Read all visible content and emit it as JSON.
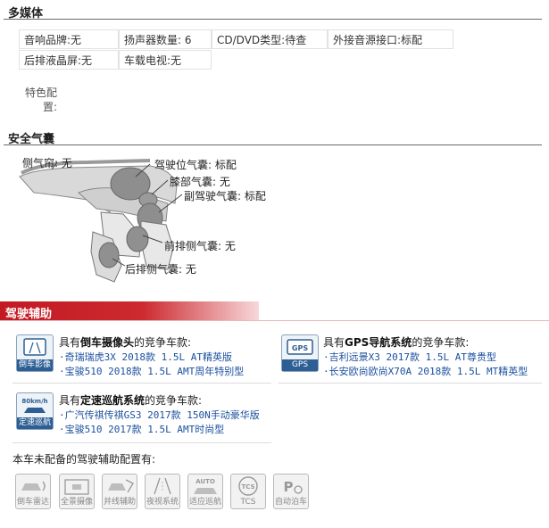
{
  "multimedia": {
    "title": "多媒体",
    "rows": [
      [
        {
          "label": "音响品牌:",
          "value": "无"
        },
        {
          "label": "扬声器数量:",
          "value": "6"
        },
        {
          "label": "CD/DVD类型:",
          "value": "待查"
        },
        {
          "label": "外接音源接口:",
          "value": "标配"
        }
      ],
      [
        {
          "label": "后排液晶屏:",
          "value": "无"
        },
        {
          "label": "车载电视:",
          "value": "无"
        }
      ]
    ],
    "special_label_line1": "特色配",
    "special_label_line2": "置:"
  },
  "airbags": {
    "title": "安全气囊",
    "items": [
      {
        "label": "侧气帘:",
        "value": "无"
      },
      {
        "label": "驾驶位气囊:",
        "value": "标配"
      },
      {
        "label": "膝部气囊:",
        "value": "无"
      },
      {
        "label": "副驾驶气囊:",
        "value": "标配"
      },
      {
        "label": "前排侧气囊:",
        "value": "无"
      },
      {
        "label": "后排侧气囊:",
        "value": "无"
      }
    ]
  },
  "assist": {
    "title": "驾驶辅助",
    "features": [
      {
        "icon_caption": "倒车影像",
        "title_prefix": "具有",
        "title_feature": "倒车摄像头",
        "title_suffix": "的竞争车款:",
        "links": [
          "奇瑞瑞虎3X 2018款 1.5L AT精英版",
          "宝骏510 2018款 1.5L AMT周年特别型"
        ]
      },
      {
        "icon_caption": "GPS",
        "icon_badge": "GPS",
        "title_prefix": "具有",
        "title_feature": "GPS导航系统",
        "title_suffix": "的竞争车款:",
        "links": [
          "吉利远景X3 2017款 1.5L AT尊贵型",
          "长安欧尚欧尚X70A 2018款 1.5L MT精英型"
        ]
      },
      {
        "icon_caption": "定速巡航",
        "icon_badge": "80km/h",
        "title_prefix": "具有",
        "title_feature": "定速巡航系统",
        "title_suffix": "的竞争车款:",
        "links": [
          "广汽传祺传祺GS3 2017款 150N手动豪华版",
          "宝骏510 2017款 1.5L AMT时尚型"
        ]
      }
    ],
    "missing_title": "本车未配备的驾驶辅助配置有:",
    "missing": [
      {
        "caption": "倒车雷达",
        "icon": "reverse-radar-icon"
      },
      {
        "caption": "全景摄像",
        "icon": "panoramic-camera-icon"
      },
      {
        "caption": "并线辅助",
        "icon": "lane-merge-assist-icon"
      },
      {
        "caption": "夜视系统",
        "icon": "night-vision-icon"
      },
      {
        "caption": "适应巡航",
        "icon": "adaptive-cruise-icon",
        "badge": "AUTO"
      },
      {
        "caption": "TCS",
        "icon": "tcs-icon",
        "badge": "TCS"
      },
      {
        "caption": "自动泊车",
        "icon": "auto-parking-icon",
        "badge": "P"
      }
    ]
  }
}
